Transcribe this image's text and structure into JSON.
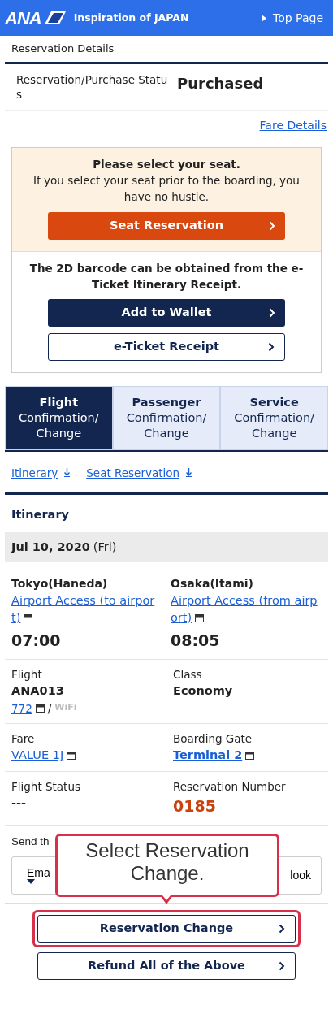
{
  "header": {
    "logo": "ANA",
    "tagline": "Inspiration of JAPAN",
    "top_link": "Top Page"
  },
  "page_title": "Reservation Details",
  "status": {
    "label": "Reservation/Purchase Status",
    "value": "Purchased"
  },
  "fare_details_link": "Fare Details",
  "seat_notice": {
    "title": "Please select your seat.",
    "text": "If you select your seat prior to the boarding, you have no hustle.",
    "button": "Seat Reservation"
  },
  "barcode_notice": {
    "text": "The 2D barcode can be obtained from the e-Ticket Itinerary Receipt.",
    "buttons": [
      {
        "label": "Add to Wallet",
        "kind": "solid"
      },
      {
        "label": "e-Ticket Receipt",
        "kind": "outline"
      }
    ]
  },
  "tabs": [
    {
      "title": "Flight",
      "subtitle": "Confirmation/Change",
      "selected": true
    },
    {
      "title": "Passenger",
      "subtitle": "Confirmation/Change",
      "selected": false
    },
    {
      "title": "Service",
      "subtitle": "Confirmation/Change",
      "selected": false
    }
  ],
  "anchors": [
    {
      "label": "Itinerary"
    },
    {
      "label": "Seat Reservation"
    }
  ],
  "itinerary": {
    "heading": "Itinerary",
    "date": "Jul 10, 2020",
    "weekday": "(Fri)",
    "departure": {
      "city": "Tokyo(Haneda)",
      "access_link": "Airport Access (to airport)",
      "time": "07:00"
    },
    "arrival": {
      "city": "Osaka(Itami)",
      "access_link": "Airport Access (from airport)",
      "time": "08:05"
    }
  },
  "details": [
    {
      "label": "Flight",
      "kind": "flight",
      "value": "ANA013",
      "link": "772",
      "separator": "/",
      "note": "WiFi"
    },
    {
      "label": "Class",
      "kind": "text",
      "value": "Economy"
    },
    {
      "label": "Fare",
      "kind": "link",
      "value": "VALUE 1J"
    },
    {
      "label": "Boarding Gate",
      "kind": "bold_link",
      "value": "Terminal 2"
    },
    {
      "label": "Flight Status",
      "kind": "text",
      "value": "---"
    },
    {
      "label": "Reservation Number",
      "kind": "highlight",
      "value": "0185"
    }
  ],
  "send": {
    "label": "Send th",
    "buttons": [
      {
        "label": "Ema",
        "kind": "dropdown"
      },
      {
        "label": "look",
        "kind": "plain"
      }
    ]
  },
  "callout": {
    "text": "Select Reservation Change."
  },
  "actions": [
    {
      "label": "Reservation Change",
      "highlighted": true
    },
    {
      "label": "Refund All of the Above",
      "highlighted": false
    }
  ]
}
